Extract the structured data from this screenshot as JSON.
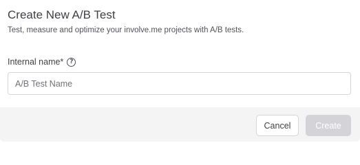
{
  "modal": {
    "title": "Create New A/B Test",
    "subtitle": "Test, measure and optimize your involve.me projects with A/B tests."
  },
  "form": {
    "internal_name_label": "Internal name*",
    "help_icon": "question-circle-icon",
    "help_glyph": "?",
    "internal_name_placeholder": "A/B Test Name",
    "internal_name_value": ""
  },
  "footer": {
    "cancel_label": "Cancel",
    "create_label": "Create",
    "create_disabled": true
  },
  "colors": {
    "footer_bg": "#f4f4f5",
    "disabled_button_bg": "#d4d4d8",
    "text": "#3f3f46",
    "border": "#d4d4d8"
  }
}
